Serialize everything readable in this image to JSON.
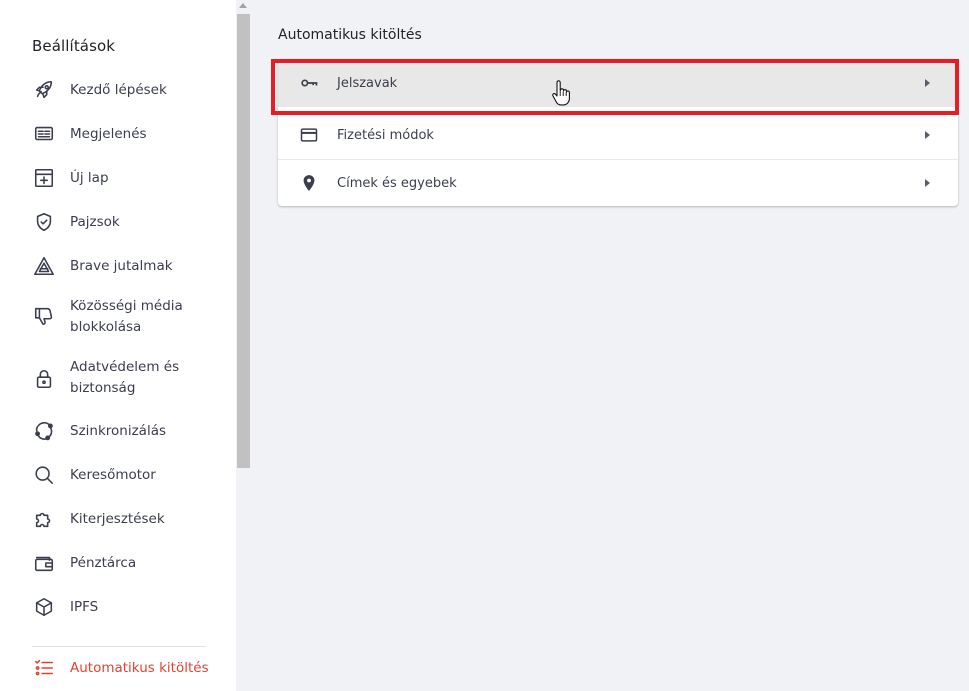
{
  "sidebar": {
    "title": "Beállítások",
    "items": [
      {
        "label": "Kezdő lépések",
        "icon": "rocket-icon"
      },
      {
        "label": "Megjelenés",
        "icon": "appearance-icon"
      },
      {
        "label": "Új lap",
        "icon": "new-tab-icon"
      },
      {
        "label": "Pajzsok",
        "icon": "shield-icon"
      },
      {
        "label": "Brave jutalmak",
        "icon": "rewards-triangle-icon"
      },
      {
        "label": "Közösségi média blokkolása",
        "icon": "thumbs-down-icon"
      },
      {
        "label": "Adatvédelem és biztonság",
        "icon": "lock-icon"
      },
      {
        "label": "Szinkronizálás",
        "icon": "sync-icon"
      },
      {
        "label": "Keresőmotor",
        "icon": "search-icon"
      },
      {
        "label": "Kiterjesztések",
        "icon": "puzzle-icon"
      },
      {
        "label": "Pénztárca",
        "icon": "wallet-icon"
      },
      {
        "label": "IPFS",
        "icon": "cube-icon"
      },
      {
        "label": "Automatikus kitöltés",
        "icon": "list-check-icon",
        "active": true
      }
    ]
  },
  "main": {
    "section_title": "Automatikus kitöltés",
    "rows": [
      {
        "label": "Jelszavak",
        "icon": "key-icon"
      },
      {
        "label": "Fizetési módok",
        "icon": "credit-card-icon"
      },
      {
        "label": "Címek és egyebek",
        "icon": "location-pin-icon"
      }
    ]
  },
  "colors": {
    "accent": "#e2432f",
    "highlight": "#e41e26",
    "background": "#f1f2f5"
  }
}
